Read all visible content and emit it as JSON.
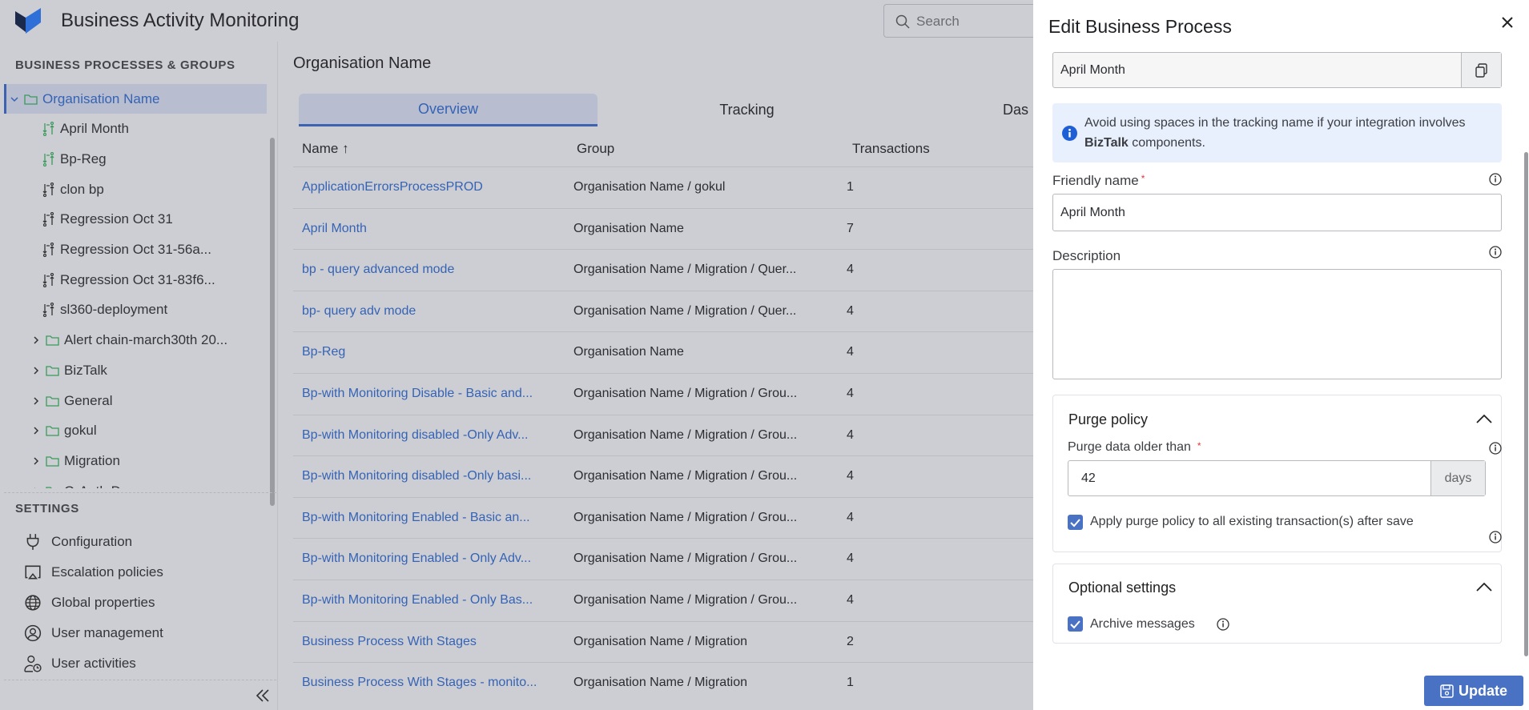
{
  "app": {
    "title": "Business Activity Monitoring",
    "search_placeholder": "Search"
  },
  "sidebar": {
    "section_title": "BUSINESS PROCESSES & GROUPS",
    "tree": [
      {
        "label": "Organisation Name",
        "type": "group",
        "expanded": true,
        "selected": true,
        "level": 0
      },
      {
        "label": "April Month",
        "type": "process",
        "active": true,
        "level": 1
      },
      {
        "label": "Bp-Reg",
        "type": "process",
        "active": true,
        "level": 1
      },
      {
        "label": "clon bp",
        "type": "process",
        "level": 1
      },
      {
        "label": "Regression Oct 31",
        "type": "process",
        "level": 1
      },
      {
        "label": "Regression Oct 31-56a...",
        "type": "process",
        "level": 1
      },
      {
        "label": "Regression Oct 31-83f6...",
        "type": "process",
        "level": 1
      },
      {
        "label": "sl360-deployment",
        "type": "process",
        "level": 1
      },
      {
        "label": "Alert chain-march30th 20...",
        "type": "group",
        "level": 1
      },
      {
        "label": "BizTalk",
        "type": "group",
        "level": 1
      },
      {
        "label": "General",
        "type": "group",
        "level": 1
      },
      {
        "label": "gokul",
        "type": "group",
        "level": 1
      },
      {
        "label": "Migration",
        "type": "group",
        "level": 1
      },
      {
        "label": "O-Auth Demo",
        "type": "group",
        "level": 1
      }
    ],
    "settings_title": "SETTINGS",
    "settings": [
      {
        "label": "Configuration",
        "icon": "plug-icon"
      },
      {
        "label": "Escalation policies",
        "icon": "escalation-icon"
      },
      {
        "label": "Global properties",
        "icon": "globe-icon"
      },
      {
        "label": "User management",
        "icon": "user-circle-icon"
      },
      {
        "label": "User activities",
        "icon": "user-clock-icon"
      }
    ]
  },
  "main": {
    "title": "Organisation Name",
    "tabs": [
      {
        "label": "Overview",
        "active": true
      },
      {
        "label": "Tracking"
      },
      {
        "label": "Das"
      }
    ],
    "columns": [
      "Name ↑",
      "Group",
      "Transactions"
    ],
    "rows": [
      [
        "ApplicationErrorsProcessPROD",
        "Organisation Name / gokul",
        "1"
      ],
      [
        "April Month",
        "Organisation Name",
        "7"
      ],
      [
        "bp - query advanced mode",
        "Organisation Name / Migration / Quer...",
        "4"
      ],
      [
        "bp- query adv mode",
        "Organisation Name / Migration / Quer...",
        "4"
      ],
      [
        "Bp-Reg",
        "Organisation Name",
        "4"
      ],
      [
        "Bp-with Monitoring Disable - Basic and...",
        "Organisation Name / Migration / Grou...",
        "4"
      ],
      [
        "Bp-with Monitoring disabled -Only Adv...",
        "Organisation Name / Migration / Grou...",
        "4"
      ],
      [
        "Bp-with Monitoring disabled -Only basi...",
        "Organisation Name / Migration / Grou...",
        "4"
      ],
      [
        "Bp-with Monitoring Enabled - Basic an...",
        "Organisation Name / Migration / Grou...",
        "4"
      ],
      [
        "Bp-with Monitoring Enabled - Only Adv...",
        "Organisation Name / Migration / Grou...",
        "4"
      ],
      [
        "Bp-with Monitoring Enabled - Only Bas...",
        "Organisation Name / Migration / Grou...",
        "4"
      ],
      [
        "Business Process With Stages",
        "Organisation Name / Migration",
        "2"
      ],
      [
        "Business Process With Stages - monito...",
        "Organisation Name / Migration",
        "1"
      ]
    ]
  },
  "panel": {
    "title": "Edit Business Process",
    "tracking_name": "April Month",
    "info_pre": "Avoid using spaces in the tracking name if your integration involves ",
    "info_bold": "BizTalk",
    "info_post": " components.",
    "friendly_label": "Friendly name",
    "friendly_value": "April Month",
    "description_label": "Description",
    "description_value": "",
    "purge": {
      "title": "Purge policy",
      "label": "Purge data older than",
      "value": "42",
      "unit": "days",
      "apply_label": "Apply purge policy to all existing transaction(s) after save",
      "apply_checked": true
    },
    "optional": {
      "title": "Optional settings",
      "archive_label": "Archive messages",
      "archive_checked": true
    },
    "update_label": "Update"
  },
  "colors": {
    "accent": "#4a72c4",
    "link": "#3563b5",
    "active_process": "#3a9a5a",
    "folder": "#3a9a5a"
  }
}
